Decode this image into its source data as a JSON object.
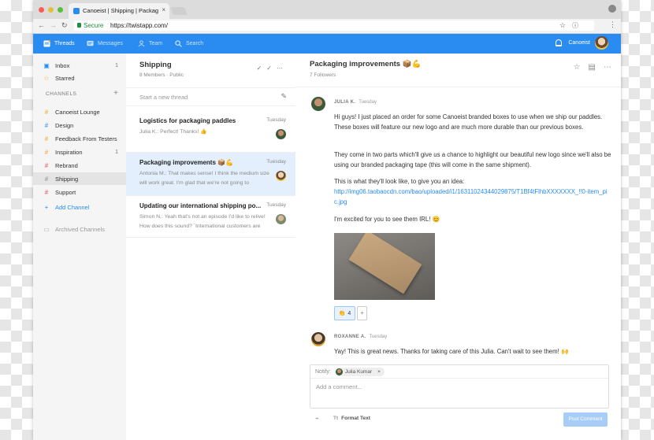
{
  "browser": {
    "tab_title": "Canoeist | Shipping | Packaging",
    "tab_close": "×",
    "secure_label": "Secure",
    "url": "https://twistapp.com/",
    "traffic_lights": [
      "#fc5b57",
      "#e5bf3c",
      "#57c038"
    ]
  },
  "appbar": {
    "threads": "Threads",
    "messages": "Messages",
    "team": "Team",
    "search": "Search",
    "workspace": "Canoeist",
    "accent": "#2a8cf0"
  },
  "sidebar": {
    "inbox": "Inbox",
    "inbox_count": "1",
    "starred": "Starred",
    "channels_title": "CHANNELS",
    "channels": [
      {
        "label": "Canoeist Lounge",
        "color": "#f5a623",
        "count": ""
      },
      {
        "label": "Design",
        "color": "#2a8cf0",
        "count": ""
      },
      {
        "label": "Feedback From Testers",
        "color": "#f5a623",
        "count": ""
      },
      {
        "label": "Inspiration",
        "color": "#f5a623",
        "count": "1"
      },
      {
        "label": "Rebrand",
        "color": "#e8505b",
        "count": ""
      },
      {
        "label": "Shipping",
        "color": "#8e8e8e",
        "count": ""
      },
      {
        "label": "Support",
        "color": "#e8505b",
        "count": ""
      }
    ],
    "add_channel": "Add Channel",
    "archived": "Archived Channels"
  },
  "threads": {
    "title": "Shipping",
    "subtitle": "8 Members · Public",
    "new_thread": "Start a new thread",
    "items": [
      {
        "title": "Logistics for packaging paddles",
        "date": "Tuesday",
        "preview": "Julia K.: Perfect! Thanks! 👍"
      },
      {
        "title": "Packaging improvements 📦💪",
        "date": "Tuesday",
        "preview": "Antonia M.: That makes sense! I think the medium size will work great. I'm glad that we're not going to"
      },
      {
        "title": "Updating our international shipping po...",
        "date": "Tuesday",
        "preview": "Simon N.: Yeah that's not an episode I'd like to relive! How does this sound? `International customers are"
      }
    ]
  },
  "main": {
    "title": "Packaging improvements 📦💪",
    "followers": "7 Followers",
    "post1": {
      "author": "JULIA K.",
      "day": "Tuesday",
      "p1": "Hi guys! I just placed an order for some Canoeist branded boxes to use when we ship our paddles. They'll feature our new logo and are much more durable than our previous boxes.",
      "p1_override": "Hi guys! I just placed an order for some Canoeist branded boxes to use when we ship our paddles. These boxes will feature our new logo and are much more durable than our previous boxes.",
      "p2": "They come in two parts which'll give us a chance to highlight our beautiful new logo since we'll also be using our branded packaging tape (this will come in the same shipment).",
      "p3": "This is what they'll look like, to give you an idea:",
      "link": "http://img06.taobaocdn.com/bao/uploaded/i1/16311024344029875/T1Bf4tFlhbXXXXXXX_!!0-item_pic.jpg",
      "p4": "I'm excited for you to see them IRL! 😊",
      "reaction_emoji": "👏",
      "reaction_count": "4",
      "reaction_add": "+"
    },
    "post2": {
      "author": "ROXANNE A.",
      "day": "Tuesday",
      "text": "Yay! This is great news. Thanks for taking care of this Julia. Can't wait to see them! 🙌"
    },
    "composer": {
      "notify_label": "Notify:",
      "chip": "Julia Kumar",
      "chip_remove": "×",
      "placeholder": "Add a comment...",
      "format": "Format Text",
      "format_glyph": "Tt",
      "post": "Post Comment"
    }
  }
}
